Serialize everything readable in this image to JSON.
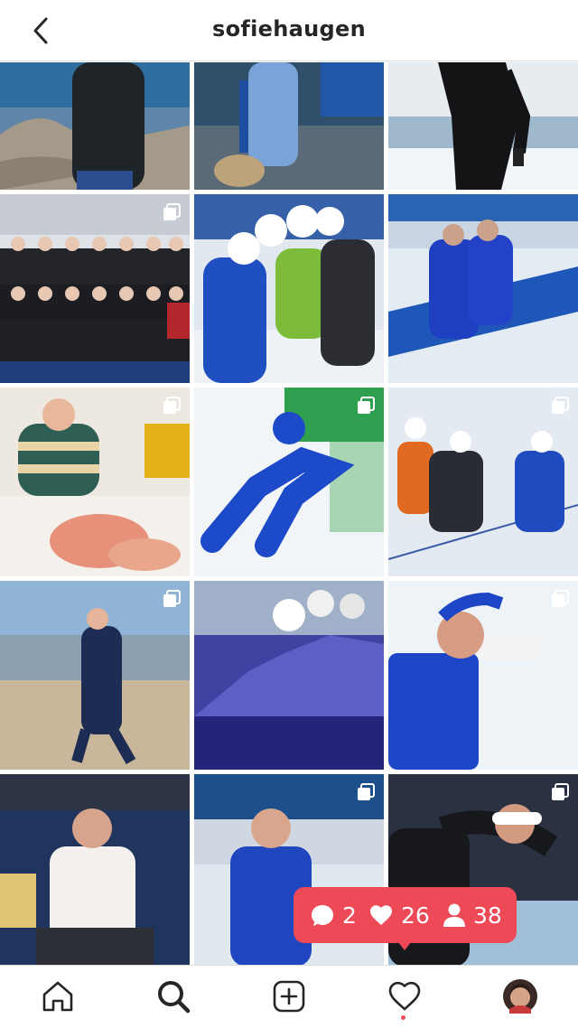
{
  "header": {
    "username": "sofiehaugen"
  },
  "grid": {
    "tiles": [
      {
        "desc": "woman in black jacket on rocky coast",
        "multi": false
      },
      {
        "desc": "person knitting on wooden dock chair",
        "multi": false
      },
      {
        "desc": "skater in black suit on ice",
        "multi": false
      },
      {
        "desc": "team photo in black jackets and masks",
        "multi": true
      },
      {
        "desc": "skaters racing in blue suits",
        "multi": true
      },
      {
        "desc": "two skaters sitting at rink side",
        "multi": false
      },
      {
        "desc": "woman with knitting in hotel room",
        "multi": true
      },
      {
        "desc": "skater in blue Statnett suit",
        "multi": true
      },
      {
        "desc": "skaters in mass start race",
        "multi": true
      },
      {
        "desc": "woman walking on beach",
        "multi": true
      },
      {
        "desc": "skaters in purple blue blur",
        "multi": false
      },
      {
        "desc": "skater with glasses on head",
        "multi": true
      },
      {
        "desc": "woman sitting in blue chair",
        "multi": false
      },
      {
        "desc": "skater at indoor rink",
        "multi": true
      },
      {
        "desc": "skater in black suit with white headband",
        "multi": true
      }
    ]
  },
  "notification": {
    "comments": "2",
    "likes": "26",
    "follows": "38"
  },
  "colors": {
    "accent": "#ed4956",
    "text": "#262626"
  }
}
